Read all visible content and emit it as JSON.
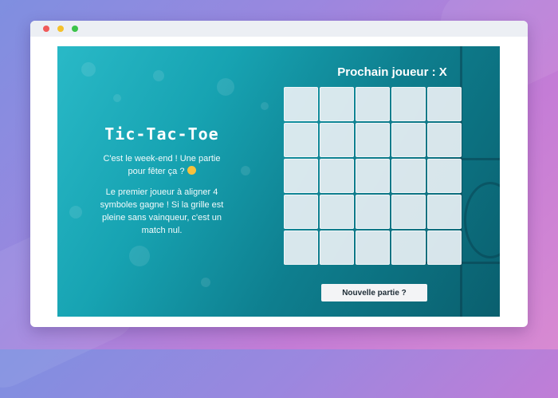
{
  "game": {
    "title": "Tic-Tac-Toe",
    "intro": "C'est le week-end ! Une partie pour fêter ça ?",
    "rules": "Le premier joueur à aligner 4 symboles gagne ! Si la grille est pleine sans vainqueur, c'est un match nul.",
    "next_player": "Prochain joueur : X",
    "new_game_label": "Nouvelle partie ?",
    "board": [
      [
        "",
        "",
        "",
        "",
        ""
      ],
      [
        "",
        "",
        "",
        "",
        ""
      ],
      [
        "",
        "",
        "",
        "",
        ""
      ],
      [
        "",
        "",
        "",
        "",
        ""
      ],
      [
        "",
        "",
        "",
        "",
        ""
      ]
    ]
  },
  "colors": {
    "teal_accent": "#17a3b2",
    "cell": "#e9f0f4",
    "button": "#f3f4f6"
  },
  "icons": {
    "emoji": "grinning-face-icon"
  }
}
